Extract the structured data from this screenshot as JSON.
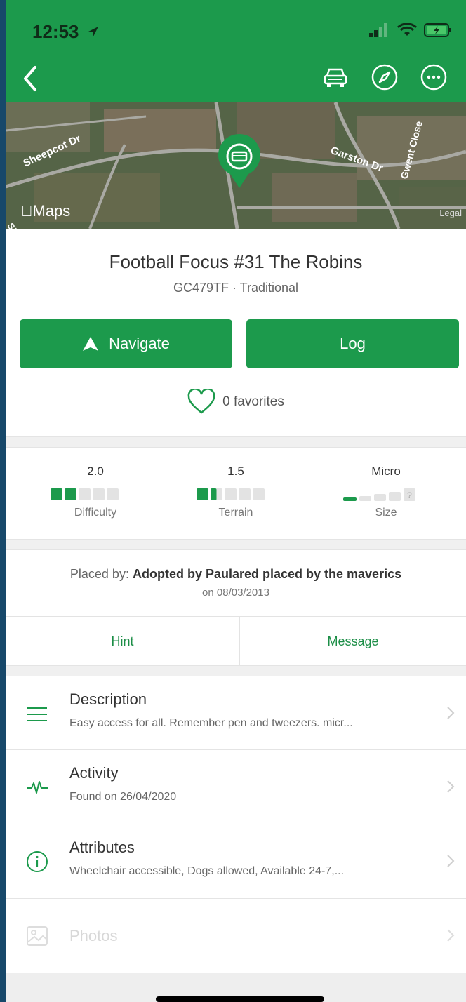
{
  "status": {
    "time": "12:53"
  },
  "map": {
    "label": "Maps",
    "legal": "Legal",
    "streets": [
      "Sheepcot Dr",
      "Garston Dr",
      "Gwent Close",
      "Sheepcot"
    ]
  },
  "header": {
    "icons": [
      "back-icon",
      "car-icon",
      "compass-icon",
      "more-icon"
    ]
  },
  "cache": {
    "title": "Football Focus #31 The Robins",
    "code_type": "GC479TF · Traditional",
    "navigate_label": "Navigate",
    "log_label": "Log",
    "favorites": "0 favorites"
  },
  "ratings": {
    "difficulty": {
      "value": "2.0",
      "label": "Difficulty",
      "level": 2.0
    },
    "terrain": {
      "value": "1.5",
      "label": "Terrain",
      "level": 1.5
    },
    "size": {
      "value": "Micro",
      "label": "Size"
    }
  },
  "placed": {
    "prefix": "Placed by:",
    "by": "Adopted by Paulared placed by the maverics",
    "date": "on 08/03/2013"
  },
  "actions": {
    "hint": "Hint",
    "message": "Message"
  },
  "sections": [
    {
      "title": "Description",
      "subtitle": "Easy access for all. Remember pen and tweezers. micr..."
    },
    {
      "title": "Activity",
      "subtitle": "Found on 26/04/2020"
    },
    {
      "title": "Attributes",
      "subtitle": "Wheelchair accessible, Dogs allowed, Available 24-7,..."
    },
    {
      "title": "Photos",
      "subtitle": ""
    }
  ],
  "colors": {
    "brand": "#1c9a4c",
    "frame": "#17486a"
  }
}
